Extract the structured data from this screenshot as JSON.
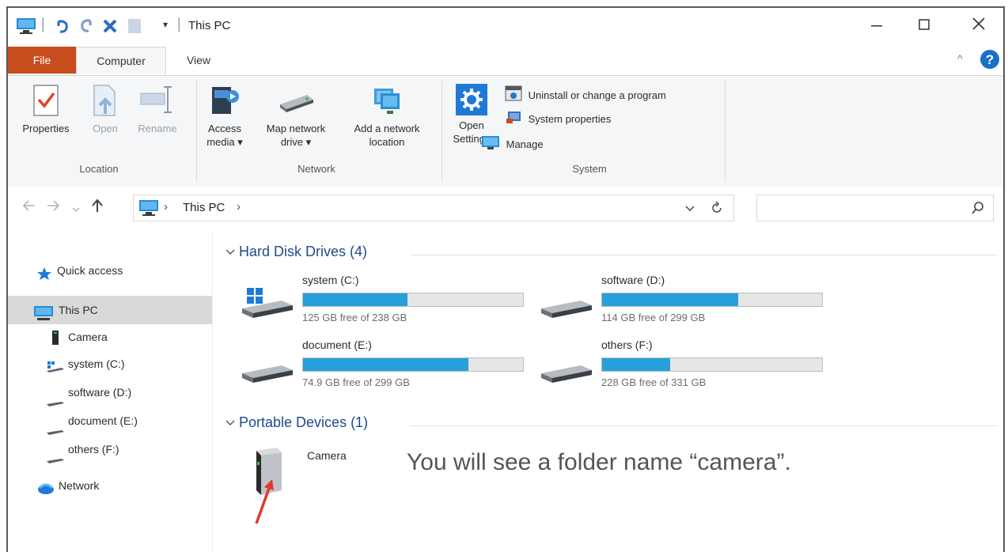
{
  "window": {
    "title": "This PC",
    "quick_access_dropdown": "▾"
  },
  "tabs": {
    "file": "File",
    "computer": "Computer",
    "view": "View"
  },
  "ribbon": {
    "location": {
      "label": "Location",
      "properties": "Properties",
      "open": "Open",
      "rename": "Rename"
    },
    "network": {
      "label": "Network",
      "access_media_1": "Access",
      "access_media_2": "media ▾",
      "map_drive_1": "Map network",
      "map_drive_2": "drive ▾",
      "add_location_1": "Add a network",
      "add_location_2": "location"
    },
    "system": {
      "label": "System",
      "open_settings_1": "Open",
      "open_settings_2": "Settings",
      "uninstall": "Uninstall or change a program",
      "system_properties": "System properties",
      "manage": "Manage"
    }
  },
  "address": {
    "crumb": "This PC",
    "separator": "›"
  },
  "nav": {
    "quick_access": "Quick access",
    "this_pc": "This PC",
    "camera": "Camera",
    "system_c": "system (C:)",
    "software_d": "software (D:)",
    "document_e": "document (E:)",
    "others_f": "others (F:)",
    "network": "Network"
  },
  "hard_disk_drives": {
    "title": "Hard Disk Drives (4)",
    "drives": [
      {
        "name": "system (C:)",
        "free_text": "125 GB free of 238 GB",
        "used_fraction": 0.475
      },
      {
        "name": "software (D:)",
        "free_text": "114 GB free of 299 GB",
        "used_fraction": 0.619
      },
      {
        "name": "document (E:)",
        "free_text": "74.9 GB free of 299 GB",
        "used_fraction": 0.75
      },
      {
        "name": "others (F:)",
        "free_text": "228 GB free of 331 GB",
        "used_fraction": 0.311
      }
    ]
  },
  "portable_devices": {
    "title": "Portable Devices (1)",
    "camera": "Camera"
  },
  "annotation": "You will see a folder name “camera”.",
  "colors": {
    "file_tab": "#c84d1e",
    "drive_fill": "#26a0da",
    "section_title": "#1e4a8c",
    "arrow": "#e03a2a"
  }
}
